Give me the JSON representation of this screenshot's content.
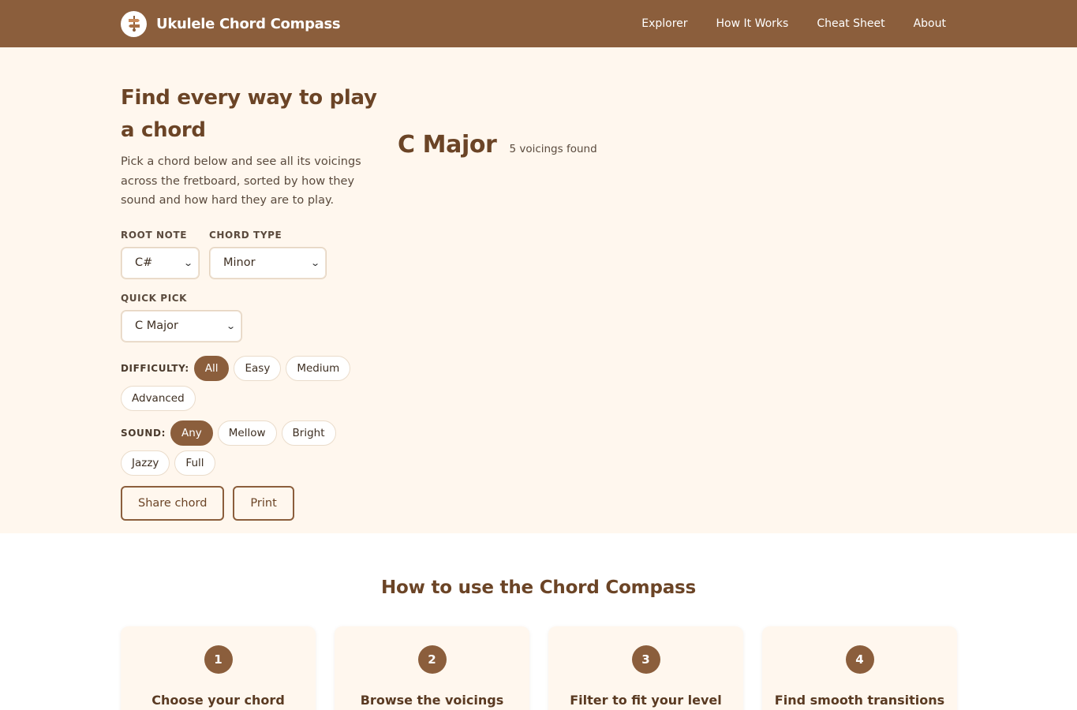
{
  "app": {
    "title": "Ukulele Chord Compass",
    "logo_icon": "ukulele-signpost-icon"
  },
  "nav": {
    "items": [
      "Explorer",
      "How It Works",
      "Cheat Sheet",
      "About"
    ]
  },
  "hero": {
    "heading": "Find every way to play a chord",
    "description": "Pick a chord below and see all its voicings across the fretboard, sorted by how they sound and how hard they are to play.",
    "root_note": {
      "label": "ROOT NOTE",
      "value": "C#"
    },
    "chord_type": {
      "label": "CHORD TYPE",
      "value": "Minor"
    },
    "quick_pick": {
      "label": "QUICK PICK",
      "value": "C Major"
    },
    "difficulty": {
      "label": "DIFFICULTY:",
      "options": [
        "All",
        "Easy",
        "Medium",
        "Advanced"
      ],
      "selected": "All"
    },
    "sound": {
      "label": "SOUND:",
      "options": [
        "Any",
        "Mellow",
        "Bright",
        "Jazzy",
        "Full"
      ],
      "selected": "Any"
    },
    "share_label": "Share chord",
    "print_label": "Print"
  },
  "results": {
    "chord_name": "C Major",
    "count_text": "5 voicings found"
  },
  "how": {
    "title": "How to use the Chord Compass",
    "steps": [
      {
        "number": "1",
        "title": "Choose your chord"
      },
      {
        "number": "2",
        "title": "Browse the voicings"
      },
      {
        "number": "3",
        "title": "Filter to fit your level"
      },
      {
        "number": "4",
        "title": "Find smooth transitions"
      }
    ]
  },
  "colors": {
    "brand": "#8b5e3c",
    "hero_bg": "#fff7ee",
    "heading": "#6b4426"
  }
}
